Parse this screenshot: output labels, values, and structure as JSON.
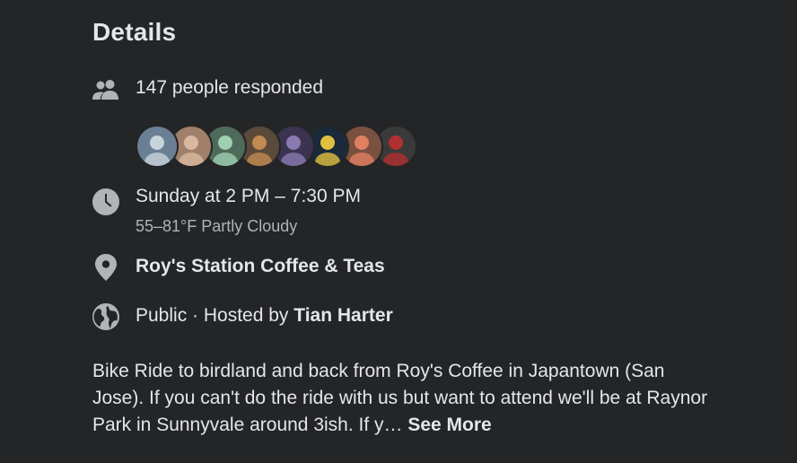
{
  "details": {
    "heading": "Details",
    "responded_text": "147 people responded",
    "avatars": [
      {
        "name": "avatar-1",
        "bg": "#6a7f94",
        "fg": "#c9d3dc"
      },
      {
        "name": "avatar-2",
        "bg": "#a0806a",
        "fg": "#d9b8a0"
      },
      {
        "name": "avatar-3",
        "bg": "#4e6a5a",
        "fg": "#9fd0b0"
      },
      {
        "name": "avatar-4",
        "bg": "#5a4a3a",
        "fg": "#c08a50"
      },
      {
        "name": "avatar-5",
        "bg": "#3a3450",
        "fg": "#8a7ab0"
      },
      {
        "name": "avatar-6",
        "bg": "#1a2a3a",
        "fg": "#e0c040"
      },
      {
        "name": "avatar-7",
        "bg": "#7a5040",
        "fg": "#e08060"
      },
      {
        "name": "avatar-8",
        "bg": "#3a3a3a",
        "fg": "#b03030"
      }
    ],
    "time": {
      "text": "Sunday at 2 PM – 7:30 PM",
      "weather": "55–81°F Partly Cloudy"
    },
    "location": {
      "text": "Roy's Station Coffee & Teas"
    },
    "privacy": {
      "prefix": "Public · Hosted by ",
      "host": "Tian Harter"
    },
    "description": {
      "text": "Bike Ride to birdland and back from Roy's Coffee in Japantown (San Jose). If you can't do the ride with us but want to attend we'll be at Raynor Park in Sunnyvale around 3ish. If y…",
      "see_more": "See More"
    }
  },
  "colors": {
    "background": "#242526",
    "primary_text": "#e4e6eb",
    "secondary_text": "#b0b3b8",
    "icon": "#b0b3b8"
  }
}
